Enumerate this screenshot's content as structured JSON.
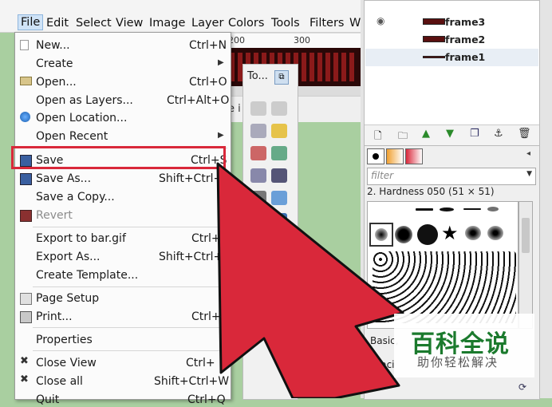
{
  "menubar": {
    "items": [
      "File",
      "Edit",
      "Select",
      "View",
      "Image",
      "Layer",
      "Colors",
      "Tools",
      "Filters",
      "W"
    ]
  },
  "ruler": {
    "marks": [
      "200",
      "300"
    ]
  },
  "statusbar": {
    "text": "e i"
  },
  "toolbox": {
    "title": "To..."
  },
  "file_menu": {
    "items": [
      {
        "label": "New...",
        "shortcut": "Ctrl+N"
      },
      {
        "label": "Create",
        "submenu": true
      },
      {
        "label": "Open...",
        "shortcut": "Ctrl+O"
      },
      {
        "label": "Open as Layers...",
        "shortcut": "Ctrl+Alt+O"
      },
      {
        "label": "Open Location..."
      },
      {
        "label": "Open Recent",
        "submenu": true
      },
      {
        "label": "Save",
        "shortcut": "Ctrl+S"
      },
      {
        "label": "Save As...",
        "shortcut": "Shift+Ctrl+"
      },
      {
        "label": "Save a Copy..."
      },
      {
        "label": "Revert",
        "disabled": true
      },
      {
        "label": "Export to bar.gif",
        "shortcut": "Ctrl+"
      },
      {
        "label": "Export As...",
        "shortcut": "Shift+Ctrl+"
      },
      {
        "label": "Create Template..."
      },
      {
        "label": "Page Setup"
      },
      {
        "label": "Print...",
        "shortcut": "Ctrl+"
      },
      {
        "label": "Properties"
      },
      {
        "label": "Close View",
        "shortcut": "Ctrl+"
      },
      {
        "label": "Close all",
        "shortcut": "Shift+Ctrl+W"
      },
      {
        "label": "Quit",
        "shortcut": "Ctrl+Q"
      }
    ]
  },
  "layers": {
    "items": [
      "frame3",
      "frame2",
      "frame1"
    ]
  },
  "brushes": {
    "filter_placeholder": "filter",
    "selected": "2. Hardness 050 (51 × 51)",
    "preset": "Basic,",
    "spacing": "Spaci"
  },
  "watermark": {
    "title": "百科全说",
    "subtitle": "助你轻松解决"
  },
  "colors": {
    "highlight": "#d9283a",
    "arrow": "#d9283a",
    "watermark_green": "#1b7a2d"
  }
}
